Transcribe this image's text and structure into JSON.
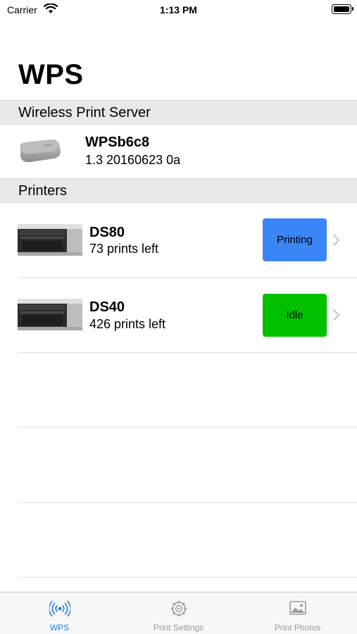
{
  "status_bar": {
    "carrier": "Carrier",
    "time": "1:13 PM"
  },
  "header": {
    "title": "WPS"
  },
  "sections": {
    "server_title": "Wireless Print Server",
    "printers_title": "Printers"
  },
  "server": {
    "name": "WPSb6c8",
    "version": "1.3 20160623 0a"
  },
  "printers": [
    {
      "name": "DS80",
      "prints": "73 prints left",
      "status": "Printing",
      "status_color": "#3a86f6"
    },
    {
      "name": "DS40",
      "prints": "426 prints left",
      "status": "Idle",
      "status_color": "#00c000"
    }
  ],
  "tabs": [
    {
      "label": "WPS",
      "icon": "wireless-icon",
      "active": true
    },
    {
      "label": "Print Settings",
      "icon": "settings-gear-icon",
      "active": false
    },
    {
      "label": "Print Photos",
      "icon": "photo-icon",
      "active": false
    }
  ],
  "colors": {
    "accent": "#1a82e6",
    "section_bg": "#e9e9e9",
    "tab_inactive": "#9a9a9a"
  }
}
